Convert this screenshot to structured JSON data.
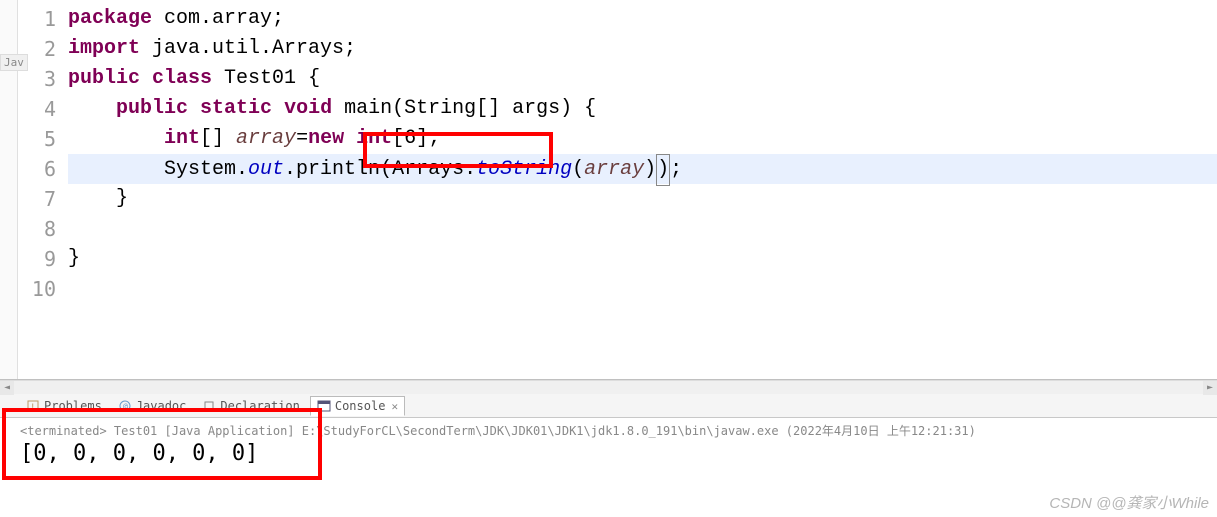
{
  "code": {
    "lines": [
      "1",
      "2",
      "3",
      "4",
      "5",
      "6",
      "7",
      "8",
      "9",
      "10"
    ],
    "t": {
      "package": "package",
      "pkg_name": " com.array;",
      "import": "import",
      "import_rest": " java.util.Arrays;",
      "public": "public",
      "class": "class",
      "classname": " Test01 {",
      "static": "static",
      "void": "void",
      "main_sig": " main(String[] args) {",
      "int": "int",
      "brackets": "[] ",
      "array_var": "array",
      "eq": "=",
      "new": "new",
      "intdim": "[6];",
      "sys": "        System.",
      "out": "out",
      "println": ".println(Arrays.",
      "tostring": "toString",
      "arr_arg": "array",
      "open_p": "(",
      "close_p": ")",
      "close_p2": ")",
      "semi": ";",
      "brace_close1": "    }",
      "brace_close2": "}",
      "sp4": "    ",
      "sp8": "        "
    }
  },
  "views": {
    "problems": "Problems",
    "javadoc": "Javadoc",
    "declaration": "Declaration",
    "console": "Console"
  },
  "console": {
    "status": "<terminated> Test01 [Java Application] E:\\StudyForCL\\SecondTerm\\JDK\\JDK01\\JDK1\\jdk1.8.0_191\\bin\\javaw.exe (2022年4月10日 上午12:21:31)",
    "output": "[0, 0, 0, 0, 0, 0]"
  },
  "watermark": "CSDN @@龚家小While",
  "side_tab": "Jav"
}
